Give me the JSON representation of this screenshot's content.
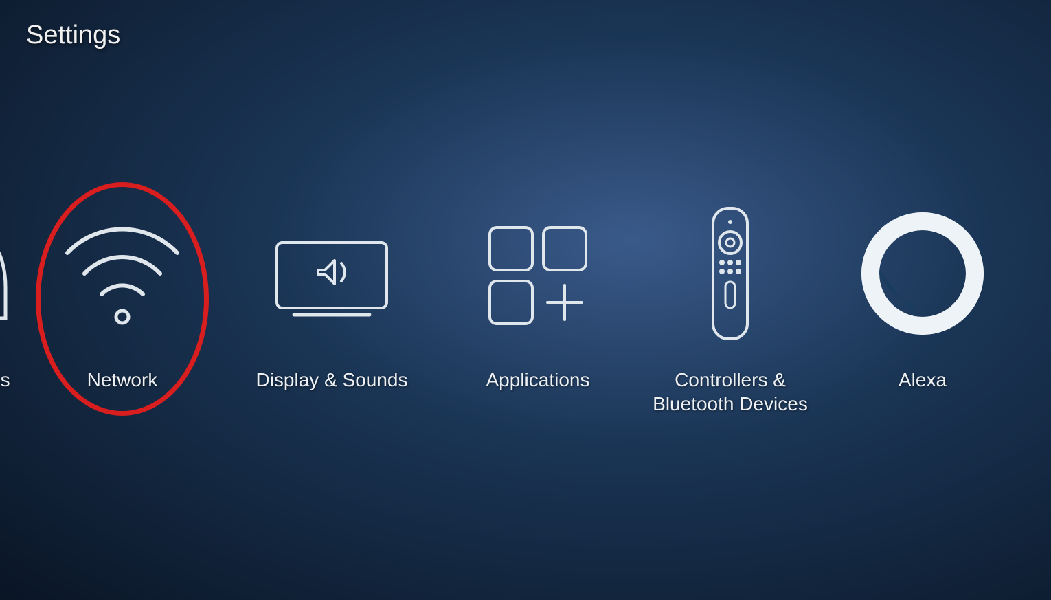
{
  "page_title": "Settings",
  "tiles": {
    "partial": {
      "label": "tions"
    },
    "network": {
      "label": "Network"
    },
    "display": {
      "label": "Display & Sounds"
    },
    "apps": {
      "label": "Applications"
    },
    "controllers": {
      "label": "Controllers & Bluetooth Devices"
    },
    "alexa": {
      "label": "Alexa"
    }
  },
  "highlighted": "network"
}
